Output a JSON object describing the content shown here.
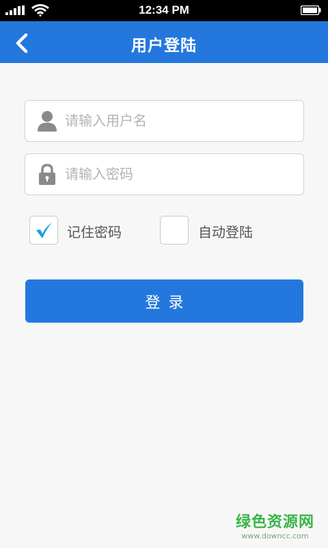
{
  "status_bar": {
    "time": "12:34 PM",
    "icons": [
      "signal-icon",
      "wifi-icon",
      "battery-icon"
    ]
  },
  "nav": {
    "title": "用户登陆",
    "back_icon": "chevron-left-icon",
    "background": "#2478dd"
  },
  "form": {
    "username": {
      "placeholder": "请输入用户名",
      "value": "",
      "icon": "user-icon"
    },
    "password": {
      "placeholder": "请输入密码",
      "value": "",
      "icon": "lock-icon"
    },
    "remember": {
      "label": "记住密码",
      "checked": true
    },
    "auto_login": {
      "label": "自动登陆",
      "checked": false
    },
    "submit_label": "登录"
  },
  "watermark": {
    "title": "绿色资源网",
    "url": "www.downcc.com"
  },
  "colors": {
    "accent": "#2478dd",
    "check": "#1ba1e2",
    "background": "#f7f7f7"
  }
}
